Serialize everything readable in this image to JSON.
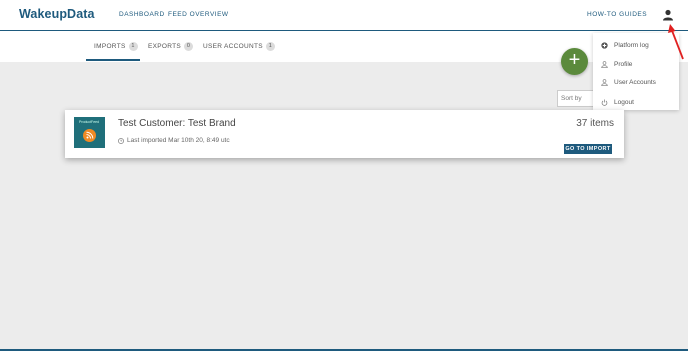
{
  "header": {
    "logo": "WakeupData",
    "nav": {
      "dashboard": "DASHBOARD",
      "feed_overview": "FEED OVERVIEW",
      "how_to_guides": "HOW-TO GUIDES"
    },
    "user_icon": "person-icon"
  },
  "tabs": [
    {
      "label": "IMPORTS",
      "count": "1"
    },
    {
      "label": "EXPORTS",
      "count": "0"
    },
    {
      "label": "USER ACCOUNTS",
      "count": "1"
    }
  ],
  "add_button": "+",
  "sort": {
    "label": "Sort by"
  },
  "dropdown": {
    "items": [
      {
        "label": "Platform log",
        "icon": "plus-circle-icon"
      },
      {
        "label": "Profile",
        "icon": "person-icon"
      },
      {
        "label": "User Accounts",
        "icon": "person-icon"
      },
      {
        "label": "Logout",
        "icon": "power-icon"
      }
    ]
  },
  "import_card": {
    "thumbnail_text": "ProductFeed",
    "title": "Test Customer: Test Brand",
    "last_imported": "Last imported Mar 10th 20, 8:49 utc",
    "count": "37 items",
    "go_button": "GO TO IMPORT"
  },
  "colors": {
    "primary": "#1e5a7d",
    "add_button": "#5b8a3c",
    "arrow": "#e02020"
  }
}
